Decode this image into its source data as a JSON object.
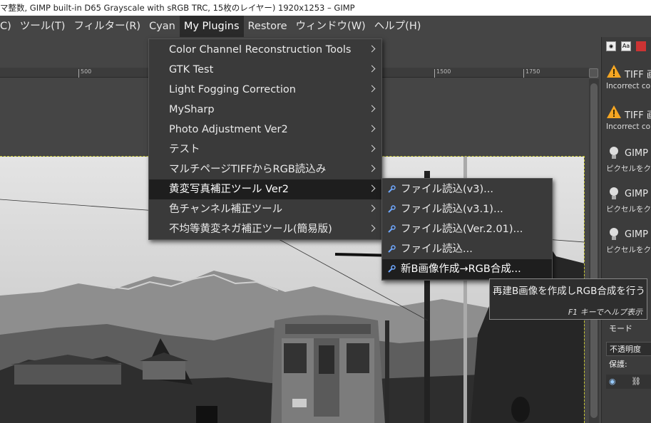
{
  "window": {
    "title": "マ整数, GIMP built-in D65 Grayscale with sRGB TRC, 15枚のレイヤー) 1920x1253 – GIMP"
  },
  "menubar": {
    "items": [
      {
        "label": "C)"
      },
      {
        "label": "ツール(T)"
      },
      {
        "label": "フィルター(R)"
      },
      {
        "label": "Cyan"
      },
      {
        "label": "My Plugins"
      },
      {
        "label": "Restore"
      },
      {
        "label": "ウィンドウ(W)"
      },
      {
        "label": "ヘルプ(H)"
      }
    ]
  },
  "ruler": {
    "ticks": [
      "500",
      "1500",
      "1750"
    ]
  },
  "my_plugins_menu": {
    "items": [
      {
        "label": "Color Channel Reconstruction Tools"
      },
      {
        "label": "GTK Test"
      },
      {
        "label": "Light Fogging Correction"
      },
      {
        "label": "MySharp"
      },
      {
        "label": "Photo Adjustment Ver2"
      },
      {
        "label": "テスト"
      },
      {
        "label": "マルチページTIFFからRGB読込み"
      },
      {
        "label": "黄変写真補正ツール Ver2"
      },
      {
        "label": "色チャンネル補正ツール"
      },
      {
        "label": "不均等黄変ネガ補正ツール(簡易版)"
      }
    ],
    "highlighted_index": 7
  },
  "submenu": {
    "items": [
      {
        "label": "ファイル読込(v3)..."
      },
      {
        "label": "ファイル読込(v3.1)..."
      },
      {
        "label": "ファイル読込(Ver.2.01)..."
      },
      {
        "label": "ファイル読込..."
      },
      {
        "label": "新B画像作成→RGB合成..."
      }
    ],
    "highlighted_index": 4
  },
  "tooltip": {
    "text": "再建B画像を作成しRGB合成を行う",
    "help_hint": "F1 キーでヘルプ表示"
  },
  "dock": {
    "tab_icons": [
      "brush-icon",
      "text-icon",
      "red-icon"
    ],
    "messages": [
      {
        "icon": "warning-icon",
        "title": "TIFF 画",
        "detail": "Incorrect co"
      },
      {
        "icon": "warning-icon",
        "title": "TIFF 画",
        "detail": "Incorrect co"
      },
      {
        "icon": "lightbulb-icon",
        "title": "GIMP",
        "detail": "ピクセルをクリ"
      },
      {
        "icon": "lightbulb-icon",
        "title": "GIMP",
        "detail": "ピクセルをクリ"
      },
      {
        "icon": "lightbulb-icon",
        "title": "GIMP",
        "detail": "ピクセルをクリ"
      }
    ],
    "mode_label": "モード",
    "opacity_label": "不透明度",
    "lock_label": "保護:"
  },
  "colors": {
    "menu_bg": "#3a3a3a",
    "highlight_bg": "#1e1e1e",
    "app_bg": "#454545",
    "warning": "#f5a623",
    "selection_dash": "#c8c832"
  }
}
